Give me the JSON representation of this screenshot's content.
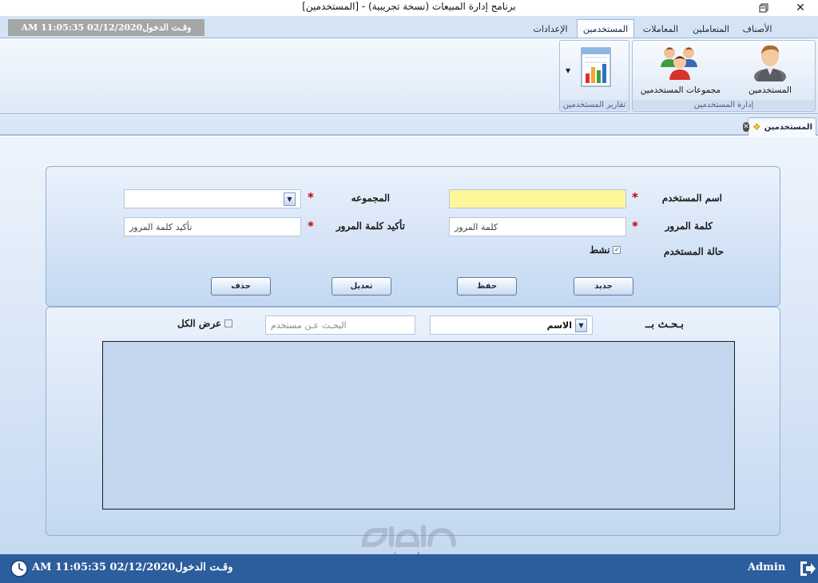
{
  "window": {
    "title": "برنامج إدارة المبيعات (نسخة تجريبية) - [المستخدمين]"
  },
  "login_badge": "وقـت الدخول02/12/2020 11:05:35 AM",
  "tabs": [
    {
      "label": "الأصناف"
    },
    {
      "label": "المتعاملين"
    },
    {
      "label": "المعاملات"
    },
    {
      "label": "المستخدمين",
      "active": true
    },
    {
      "label": "الإعدادات"
    }
  ],
  "ribbon": {
    "group_users": {
      "caption": "إدارة المستخدمين",
      "users_button": "المستخدمين",
      "groups_button": "مجموعات المستخدمين"
    },
    "group_reports": {
      "caption": "تقارير المستخدمين"
    }
  },
  "doc_tab": {
    "label": "المستخدمين"
  },
  "form": {
    "username_label": "اسم المستخدم",
    "username_value": "",
    "group_label": "المجموعه",
    "group_value": "",
    "password_label": "كلمة المرور",
    "password_placeholder": "كلمة المرور",
    "confirm_label": "تأكيد كلمة المرور",
    "confirm_placeholder": "تأكيد كلمة المرور",
    "status_label": "حالة المستخدم",
    "active_label": "نشط",
    "active_checked": true,
    "required_mark": "*",
    "buttons": {
      "new": "جديد",
      "save": "حفظ",
      "edit": "تعديل",
      "delete": "حذف"
    }
  },
  "search": {
    "label": "بـحـث بــ",
    "field_option": "الاسم",
    "placeholder": "البحـث عـن مستخدم",
    "show_all_label": "عرض الكل",
    "show_all_checked": false
  },
  "statusbar": {
    "login_time": "وقـت الدخول02/12/2020 11:05:35 AM",
    "user": "Admin"
  },
  "watermark": {
    "text": "mostaql.com"
  },
  "colors": {
    "statusbar": "#2c5d9c",
    "required": "#c00000",
    "username_field": "#fcf79a"
  }
}
